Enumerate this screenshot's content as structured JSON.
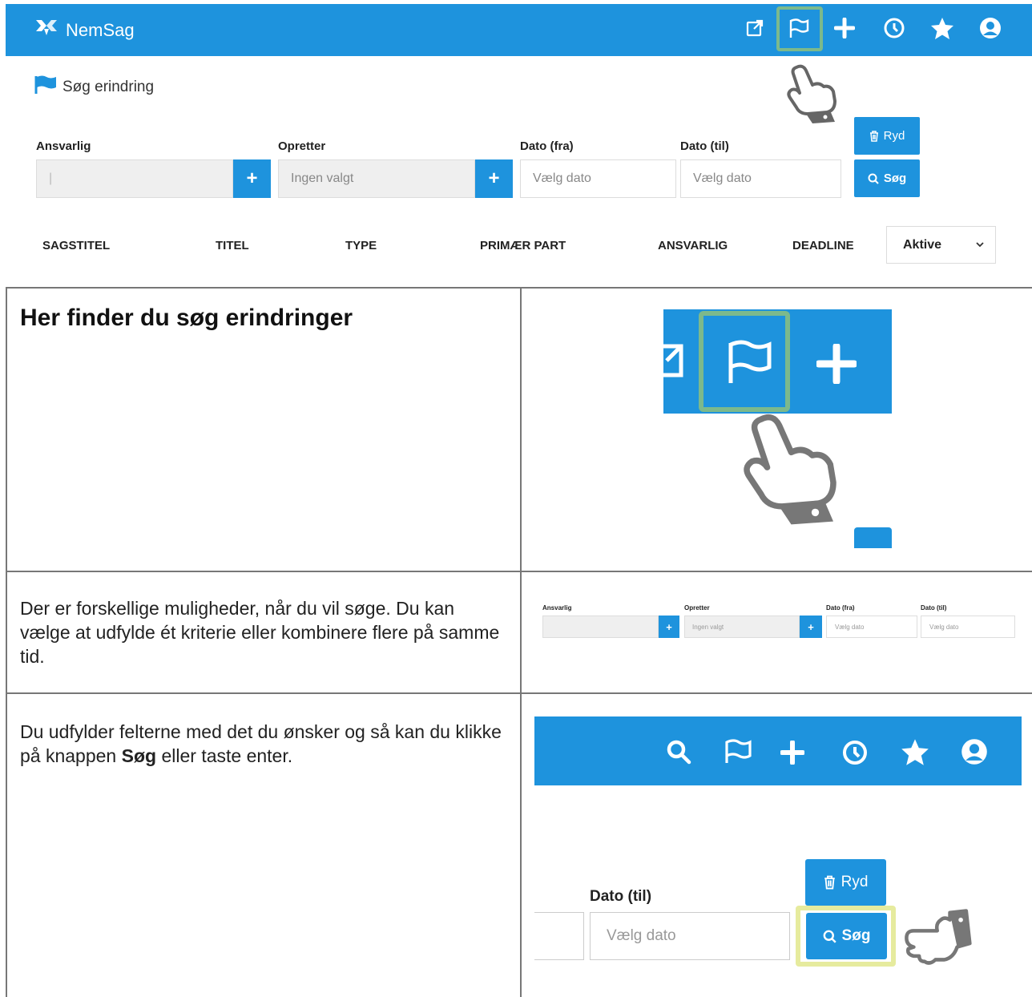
{
  "app": {
    "name": "NemSag"
  },
  "nav_icons": [
    "external-link-icon",
    "flag-icon",
    "plus-icon",
    "clock-icon",
    "star-icon",
    "user-icon"
  ],
  "page": {
    "title": "Søg erindring"
  },
  "filters": {
    "ansvarlig": {
      "label": "Ansvarlig",
      "value": "|"
    },
    "opretter": {
      "label": "Opretter",
      "placeholder": "Ingen valgt"
    },
    "dato_fra": {
      "label": "Dato (fra)",
      "placeholder": "Vælg dato"
    },
    "dato_til": {
      "label": "Dato (til)",
      "placeholder": "Vælg dato"
    },
    "plus_label": "+"
  },
  "buttons": {
    "ryd": "Ryd",
    "sog": "Søg"
  },
  "columns": [
    "SAGSTITEL",
    "TITEL",
    "TYPE",
    "PRIMÆR PART",
    "ANSVARLIG",
    "DEADLINE"
  ],
  "status_select": {
    "selected": "Aktive"
  },
  "guide": {
    "row1_title": "Her finder du søg erindringer",
    "row2_text": "Der er forskellige muligheder, når du vil søge. Du kan vælge at udfylde ét kriterie eller kombinere flere på samme tid.",
    "row3_prefix": "Du udfylder felterne med det du ønsker og så kan du klikke på knappen ",
    "row3_bold": "Søg",
    "row3_suffix": " eller taste enter."
  },
  "colors": {
    "primary": "#1e93dd",
    "highlight_green": "#7cb98c",
    "highlight_yellow": "#e6eb9e"
  }
}
